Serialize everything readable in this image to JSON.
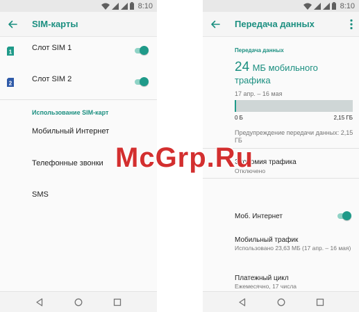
{
  "left": {
    "status": {
      "time": "8:10"
    },
    "header": {
      "title": "SIM-карты"
    },
    "sims": [
      {
        "label": "Слот SIM 1",
        "number": "1",
        "enabled": true
      },
      {
        "label": "Слот SIM 2",
        "number": "2",
        "enabled": true
      }
    ],
    "usage_section": {
      "header": "Использование SIM-карт",
      "items": [
        "Мобильный Интернет",
        "Телефонные звонки",
        "SMS"
      ]
    }
  },
  "right": {
    "status": {
      "time": "8:10"
    },
    "header": {
      "title": "Передача данных"
    },
    "section_header": "Передача данных",
    "usage": {
      "amount": "24",
      "unit_text": "МБ мобильного трафика",
      "period": "17 апр. – 16 мая",
      "progress_fraction": 0.011,
      "min_label": "0 Б",
      "max_label": "2,15 ГБ"
    },
    "warning": "Предупреждение передачи данных: 2,15 ГБ",
    "saver": {
      "title": "Экономия трафика",
      "subtitle": "Отключено"
    },
    "mobile_internet": {
      "label": "Моб. Интернет",
      "enabled": true
    },
    "mobile_traffic": {
      "title": "Мобильный трафик",
      "subtitle": "Использовано 23,63 МБ (17 апр. – 16 мая)"
    },
    "billing": {
      "title": "Платежный цикл",
      "subtitle": "Ежемесячно, 17 числа"
    }
  },
  "watermark": "McGrp.Ru",
  "colors": {
    "accent": "#1b8f80",
    "toggle_thumb": "#1f9a89",
    "toggle_track": "#8fd3c6",
    "sim_icon": "#1f9a89",
    "sim2_icon": "#2f5aa8"
  }
}
